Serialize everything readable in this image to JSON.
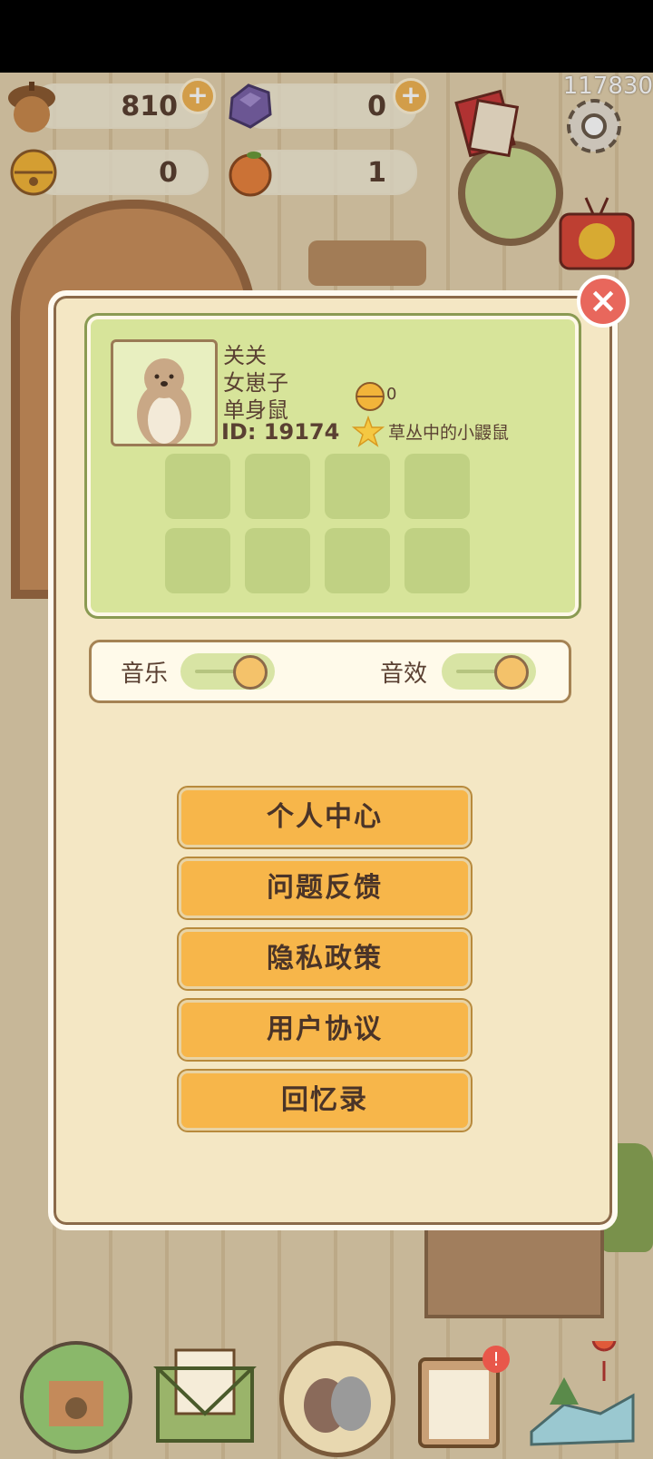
{
  "currencies": {
    "acorn": {
      "value": "810",
      "icon": "acorn-icon"
    },
    "gem": {
      "value": "0",
      "icon": "gem-icon"
    },
    "bell": {
      "value": "0",
      "icon": "bell-icon"
    },
    "orange": {
      "value": "1",
      "icon": "orange-icon"
    }
  },
  "top_right_number": "117830",
  "profile": {
    "name": "关关",
    "title1": "女崽子",
    "title2": "单身鼠",
    "id_text": "ID: 19174",
    "bell_count": "0",
    "rank_text": "草丛中的小鼹鼠"
  },
  "audio": {
    "music_label": "音乐",
    "sfx_label": "音效",
    "music_on": true,
    "sfx_on": true
  },
  "menu": [
    {
      "label": "个人中心"
    },
    {
      "label": "问题反馈"
    },
    {
      "label": "隐私政策"
    },
    {
      "label": "用户协议"
    },
    {
      "label": "回忆录"
    }
  ],
  "colors": {
    "panel_bg": "#f4e7c4",
    "button_orange": "#f7b64a",
    "profile_green": "#d7e49a",
    "close_red": "#e8675c"
  }
}
